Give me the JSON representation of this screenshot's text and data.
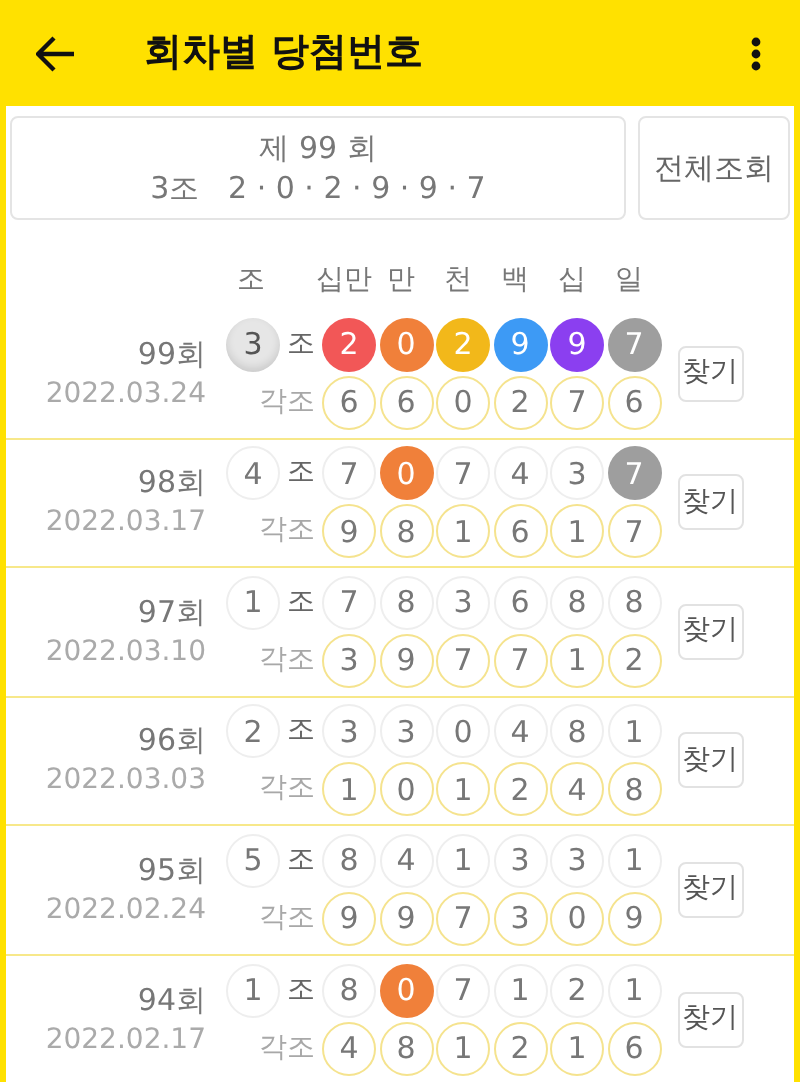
{
  "app_bar": {
    "title": "회차별 당첨번호"
  },
  "summary": {
    "round": "제 99 회",
    "numbers": "3조   2 · 0 · 2 · 9 · 9 · 7",
    "button": "전체조회"
  },
  "columns": [
    "조",
    "십만",
    "만",
    "천",
    "백",
    "십",
    "일"
  ],
  "rows": [
    {
      "round": "99회",
      "date": "2022.03.24",
      "group": {
        "value": "3",
        "matched": true
      },
      "group_label": "조",
      "numbers": [
        {
          "value": "2",
          "matched": true,
          "color": "#f25757"
        },
        {
          "value": "0",
          "matched": true,
          "color": "#f0803a"
        },
        {
          "value": "2",
          "matched": true,
          "color": "#f2b81a"
        },
        {
          "value": "9",
          "matched": true,
          "color": "#3d9af5"
        },
        {
          "value": "9",
          "matched": true,
          "color": "#8b3ff0"
        },
        {
          "value": "7",
          "matched": true,
          "color": "#9e9e9e"
        }
      ],
      "each_label": "각조",
      "each_numbers": [
        "6",
        "6",
        "0",
        "2",
        "7",
        "6"
      ],
      "button": "찾기"
    },
    {
      "round": "98회",
      "date": "2022.03.17",
      "group": {
        "value": "4",
        "matched": false
      },
      "group_label": "조",
      "numbers": [
        {
          "value": "7",
          "matched": false
        },
        {
          "value": "0",
          "matched": true,
          "color": "#f0803a"
        },
        {
          "value": "7",
          "matched": false
        },
        {
          "value": "4",
          "matched": false
        },
        {
          "value": "3",
          "matched": false
        },
        {
          "value": "7",
          "matched": true,
          "color": "#9e9e9e"
        }
      ],
      "each_label": "각조",
      "each_numbers": [
        "9",
        "8",
        "1",
        "6",
        "1",
        "7"
      ],
      "button": "찾기"
    },
    {
      "round": "97회",
      "date": "2022.03.10",
      "group": {
        "value": "1",
        "matched": false
      },
      "group_label": "조",
      "numbers": [
        {
          "value": "7",
          "matched": false
        },
        {
          "value": "8",
          "matched": false
        },
        {
          "value": "3",
          "matched": false
        },
        {
          "value": "6",
          "matched": false
        },
        {
          "value": "8",
          "matched": false
        },
        {
          "value": "8",
          "matched": false
        }
      ],
      "each_label": "각조",
      "each_numbers": [
        "3",
        "9",
        "7",
        "7",
        "1",
        "2"
      ],
      "button": "찾기"
    },
    {
      "round": "96회",
      "date": "2022.03.03",
      "group": {
        "value": "2",
        "matched": false
      },
      "group_label": "조",
      "numbers": [
        {
          "value": "3",
          "matched": false
        },
        {
          "value": "3",
          "matched": false
        },
        {
          "value": "0",
          "matched": false
        },
        {
          "value": "4",
          "matched": false
        },
        {
          "value": "8",
          "matched": false
        },
        {
          "value": "1",
          "matched": false
        }
      ],
      "each_label": "각조",
      "each_numbers": [
        "1",
        "0",
        "1",
        "2",
        "4",
        "8"
      ],
      "button": "찾기"
    },
    {
      "round": "95회",
      "date": "2022.02.24",
      "group": {
        "value": "5",
        "matched": false
      },
      "group_label": "조",
      "numbers": [
        {
          "value": "8",
          "matched": false
        },
        {
          "value": "4",
          "matched": false
        },
        {
          "value": "1",
          "matched": false
        },
        {
          "value": "3",
          "matched": false
        },
        {
          "value": "3",
          "matched": false
        },
        {
          "value": "1",
          "matched": false
        }
      ],
      "each_label": "각조",
      "each_numbers": [
        "9",
        "9",
        "7",
        "3",
        "0",
        "9"
      ],
      "button": "찾기"
    },
    {
      "round": "94회",
      "date": "2022.02.17",
      "group": {
        "value": "1",
        "matched": false
      },
      "group_label": "조",
      "numbers": [
        {
          "value": "8",
          "matched": false
        },
        {
          "value": "0",
          "matched": true,
          "color": "#f0803a"
        },
        {
          "value": "7",
          "matched": false
        },
        {
          "value": "1",
          "matched": false
        },
        {
          "value": "2",
          "matched": false
        },
        {
          "value": "1",
          "matched": false
        }
      ],
      "each_label": "각조",
      "each_numbers": [
        "4",
        "8",
        "1",
        "2",
        "1",
        "6"
      ],
      "button": "찾기"
    }
  ]
}
